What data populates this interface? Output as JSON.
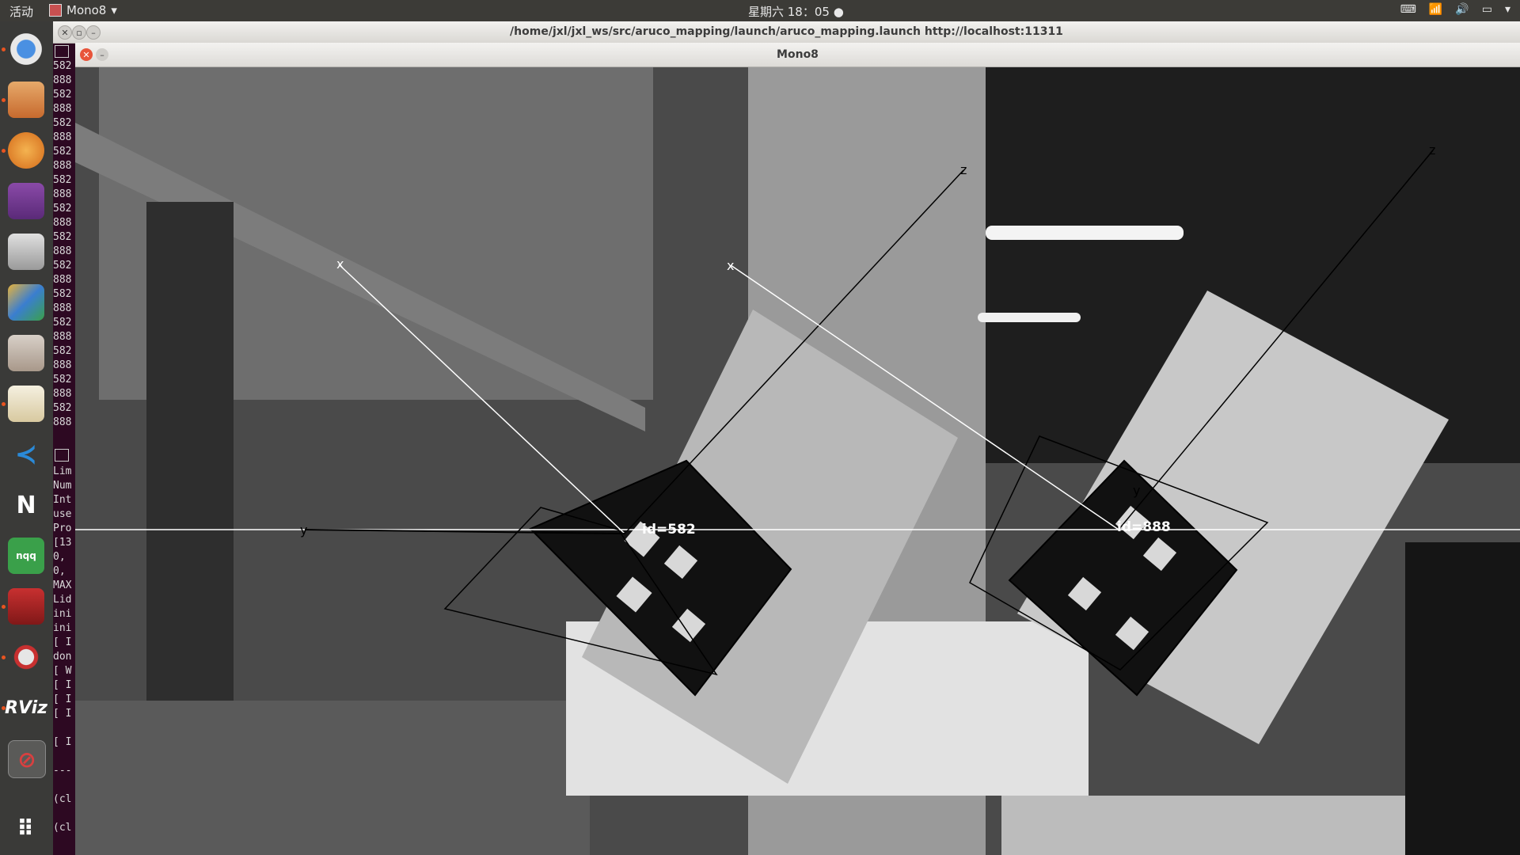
{
  "topbar": {
    "activities": "活动",
    "app_name": "Mono8",
    "clock": "星期六 18：05",
    "tray": [
      "keyboard-icon",
      "wifi-icon",
      "volume-icon",
      "battery-icon",
      "menu-arrow-icon"
    ]
  },
  "dock": {
    "items": [
      "chromium-icon",
      "files-icon",
      "shotwell-icon",
      "video-icon",
      "camera-icon",
      "paint-icon",
      "mixer-icon",
      "text-editor-icon",
      "vscode-icon",
      "n-icon",
      "nqq-icon",
      "terminal-app-icon",
      "settings-icon",
      "rviz-icon",
      "no-entry-icon",
      "apps-grid-icon"
    ],
    "labels": {
      "nqq": "nqq",
      "rviz": "RViz",
      "n": "N"
    }
  },
  "terminal": {
    "title": "/home/jxl/jxl_ws/src/aruco_mapping/launch/aruco_mapping.launch http://localhost:11311",
    "lines_top": [
      "582",
      "888",
      "582",
      "888",
      "582",
      "888",
      "582",
      "888",
      "582",
      "888",
      "582",
      "888",
      "582",
      "888",
      "582",
      "888",
      "582",
      "888",
      "582",
      "888",
      "582",
      "888",
      "582",
      "888",
      "582",
      "888"
    ],
    "lines_bottom": [
      "Lim",
      "Num",
      "Int",
      "use",
      "Pro",
      "[13",
      " 0,",
      " 0,",
      "MAX",
      "Lid",
      "ini",
      "ini",
      "[ I",
      "don",
      "[ W",
      "[ I",
      "[ I",
      "[ I",
      "",
      "[ I",
      "",
      "---",
      "",
      "(cl",
      "",
      "(cl"
    ]
  },
  "mono8": {
    "title": "Mono8",
    "markers": [
      {
        "label": "id=582",
        "axis_x": "x",
        "axis_y": "y",
        "axis_z": "z"
      },
      {
        "label": "id=888",
        "axis_x": "x",
        "axis_y": "y",
        "axis_z": "z"
      }
    ]
  }
}
